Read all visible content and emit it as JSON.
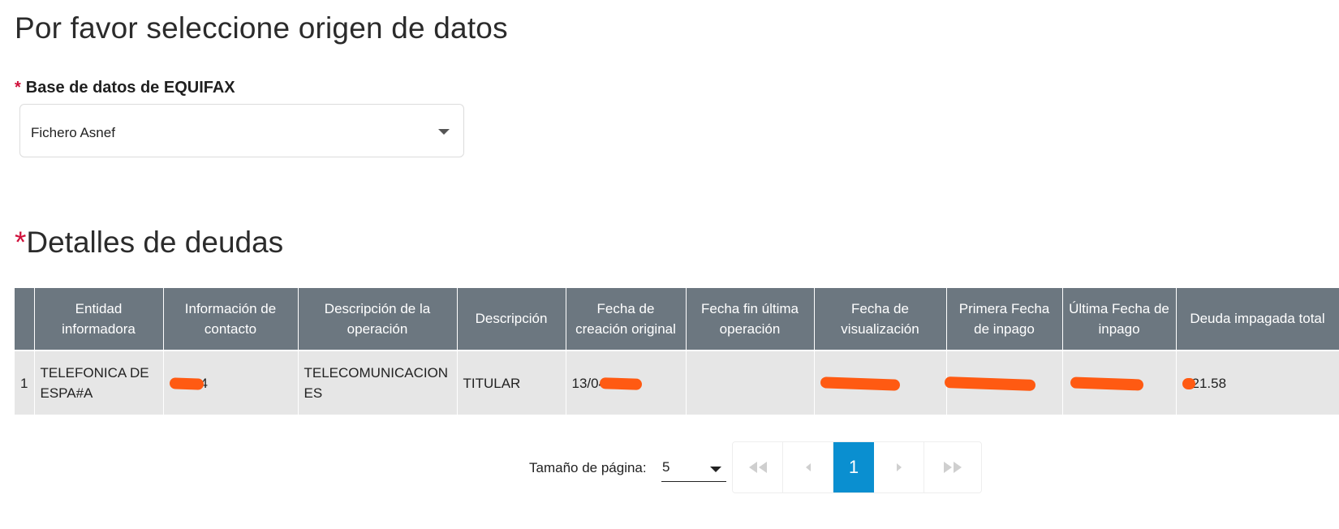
{
  "header": {
    "title": "Por favor seleccione origen de datos"
  },
  "source": {
    "required_mark": "*",
    "label": "Base de datos de EQUIFAX",
    "selected": "Fichero Asnef"
  },
  "debts": {
    "required_mark": "*",
    "title": "Detalles de deudas",
    "columns": [
      "",
      "Entidad informadora",
      "Información de contacto",
      "Descripción de la operación",
      "Descripción",
      "Fecha de creación original",
      "Fecha fin última operación",
      "Fecha de visualización",
      "Primera Fecha de inpago",
      "Última Fecha de inpago",
      "Deuda impagada total"
    ],
    "rows": [
      {
        "index": "1",
        "entity": "TELEFONICA DE ESPA#A",
        "contact": "4",
        "operation": "TELECOMUNICACIONES",
        "description": "TITULAR",
        "created": "13/04",
        "end_date": "",
        "viewed": "",
        "first_unpaid": "",
        "last_unpaid": "",
        "total": "21.58"
      }
    ]
  },
  "pagination": {
    "size_label": "Tamaño de página:",
    "size_value": "5",
    "current_page": "1",
    "first_icon": "double-chevron-left-icon",
    "prev_icon": "chevron-left-icon",
    "next_icon": "chevron-right-icon",
    "last_icon": "double-chevron-right-icon"
  },
  "colors": {
    "accent": "#0a8fd0",
    "required": "#d0103a",
    "table_header": "#6c7780",
    "row_bg": "#e6e6e6",
    "redaction": "#ff5a12"
  }
}
